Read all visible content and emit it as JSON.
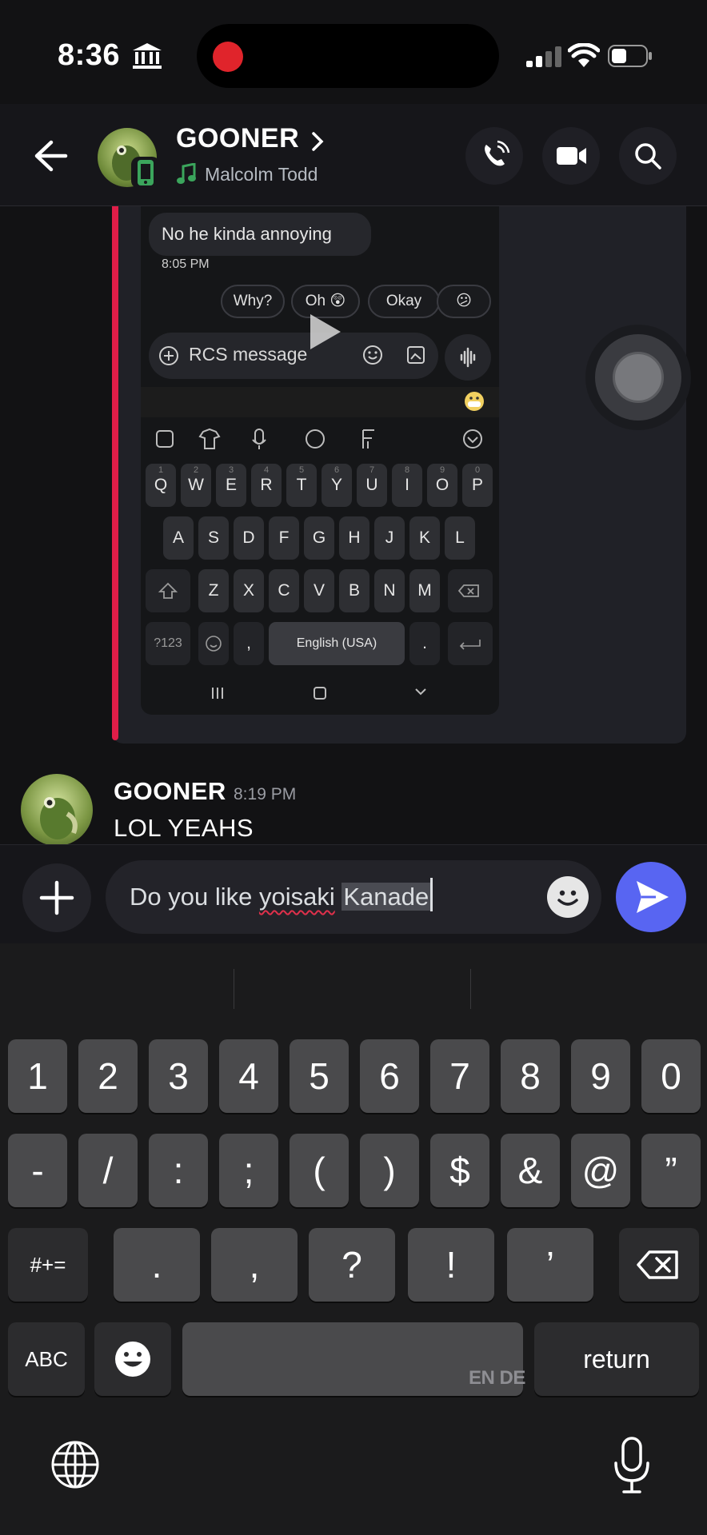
{
  "status_bar": {
    "time": "8:36"
  },
  "header": {
    "channel_name": "GOONER",
    "activity": "Malcolm Todd"
  },
  "attachment": {
    "bubble_text": "No he kinda annoying",
    "bubble_time": "8:05 PM",
    "smart_replies": [
      "Why?",
      "Oh 😲",
      "Okay",
      "😕"
    ],
    "input_placeholder": "RCS message",
    "keyboard": {
      "row1": [
        "Q",
        "W",
        "E",
        "R",
        "T",
        "Y",
        "U",
        "I",
        "O",
        "P"
      ],
      "row1_sup": [
        "1",
        "2",
        "3",
        "4",
        "5",
        "6",
        "7",
        "8",
        "9",
        "0"
      ],
      "row2": [
        "A",
        "S",
        "D",
        "F",
        "G",
        "H",
        "J",
        "K",
        "L"
      ],
      "row3": [
        "Z",
        "X",
        "C",
        "V",
        "B",
        "N",
        "M"
      ],
      "symbols_key": "?123",
      "space_label": "English (USA)",
      "comma": ",",
      "period": "."
    }
  },
  "message": {
    "author": "GOONER",
    "time": "8:19 PM",
    "text": "LOL YEAHS"
  },
  "composer": {
    "text_before": "Do you like ",
    "text_misspelled": "yoisaki",
    "text_space": " ",
    "text_selected": "Kanade"
  },
  "keyboard": {
    "row1": [
      "1",
      "2",
      "3",
      "4",
      "5",
      "6",
      "7",
      "8",
      "9",
      "0"
    ],
    "row2": [
      "-",
      "/",
      ":",
      ";",
      "(",
      ")",
      "$",
      "&",
      "@",
      "”"
    ],
    "row3_left": "#+=",
    "row3": [
      ".",
      ",",
      "?",
      "!",
      "’"
    ],
    "abc": "ABC",
    "return": "return",
    "language": "EN DE"
  }
}
